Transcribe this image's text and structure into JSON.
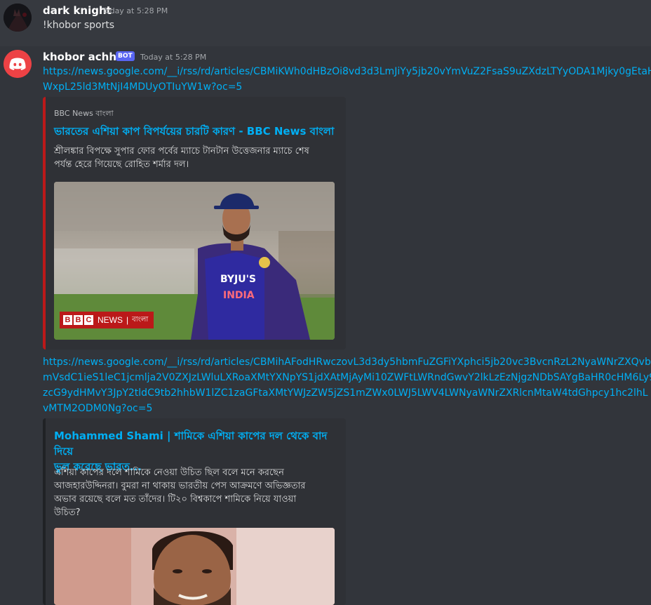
{
  "messages": [
    {
      "author": "dark knight",
      "timestamp": "Today at 5:28 PM",
      "content": "!khobor sports"
    },
    {
      "author": "khobor achhe !",
      "bot_tag": "BOT",
      "timestamp": "Today at 5:28 PM",
      "link1": [
        "https://news.google.com/__i/rss/rd/articles/CBMiKWh0dHBzOi8vd3d3LmJiYy5jb20vYmVuZ2FsaS9uZXdzLTYyODA1Mjky0gEtaH",
        "WxpL25ld3MtNjI4MDUyOTIuYW1w?oc=5"
      ],
      "embed1": {
        "provider": "BBC News বাংলা",
        "title": "ভারতের এশিয়া কাপ বিপর্যয়ের চারটি কারণ - BBC News বাংলা",
        "description": [
          "শ্রীলঙ্কার বিপক্ষে সুপার ফোর পর্বের ম্যাচে টানটান উত্তেজনার ম্যাচে শেষ",
          "পর্যন্ত হেরে গিয়েছে রোহিত শর্মার দল।"
        ],
        "image_logo": {
          "letters": [
            "B",
            "B",
            "C"
          ],
          "news": "NEWS",
          "lang": "বাংলা"
        },
        "jersey_sponsor": "BYJU'S",
        "jersey_country": "INDIA"
      },
      "link2": [
        "https://news.google.com/__i/rss/rd/articles/CBMihAFodHRwczovL3d3dy5hbmFuZGFiYXphci5jb20vc3BvcnRzL2NyaWNrZXQvbW",
        "mVsdC1ieS1leC1jcmlja2V0ZXJzLWluLXRoaXMtYXNpYS1jdXAtMjAyMi10ZWFtLWRndGwvY2lkLzEzNjgzNDbSAYgBaHR0cHM6Ly9",
        "zcG9ydHMvY3JpY2tldC9tb2hhbW1lZC1zaGFtaXMtYWJzZW5jZS1mZWx0LWJ5LWV4LWNyaWNrZXRlcnMtaW4tdGhpcy1hc2lhL",
        "vMTM2ODM0Ng?oc=5"
      ],
      "embed2": {
        "title": [
          "Mohammed Shami | শামিকে এশিয়া কাপের দল থেকে বাদ দিয়ে",
          "ভুল করেছে ভারত..."
        ],
        "description": [
          "এশিয়া কাপের দলে শামিকে নেওয়া উচিত ছিল বলে মনে করছেন",
          "আজহারউদ্দিনরা। বুমরা না থাকায় ভারতীয় পেস আক্রমণে অভিজ্ঞতার",
          "অভাব রয়েছে বলে মত তাঁদের। টি২০ বিশ্বকাপে শামিকে নিয়ে যাওয়া",
          "উচিত?"
        ]
      }
    }
  ],
  "colors": {
    "background": "#36393f",
    "embed_bg": "#2f3136",
    "link": "#00aff4",
    "bbc_bar": "#bb1919",
    "embed2_bar": "#202225",
    "bot_tag": "#5865f2",
    "discord_red": "#ed4245"
  }
}
